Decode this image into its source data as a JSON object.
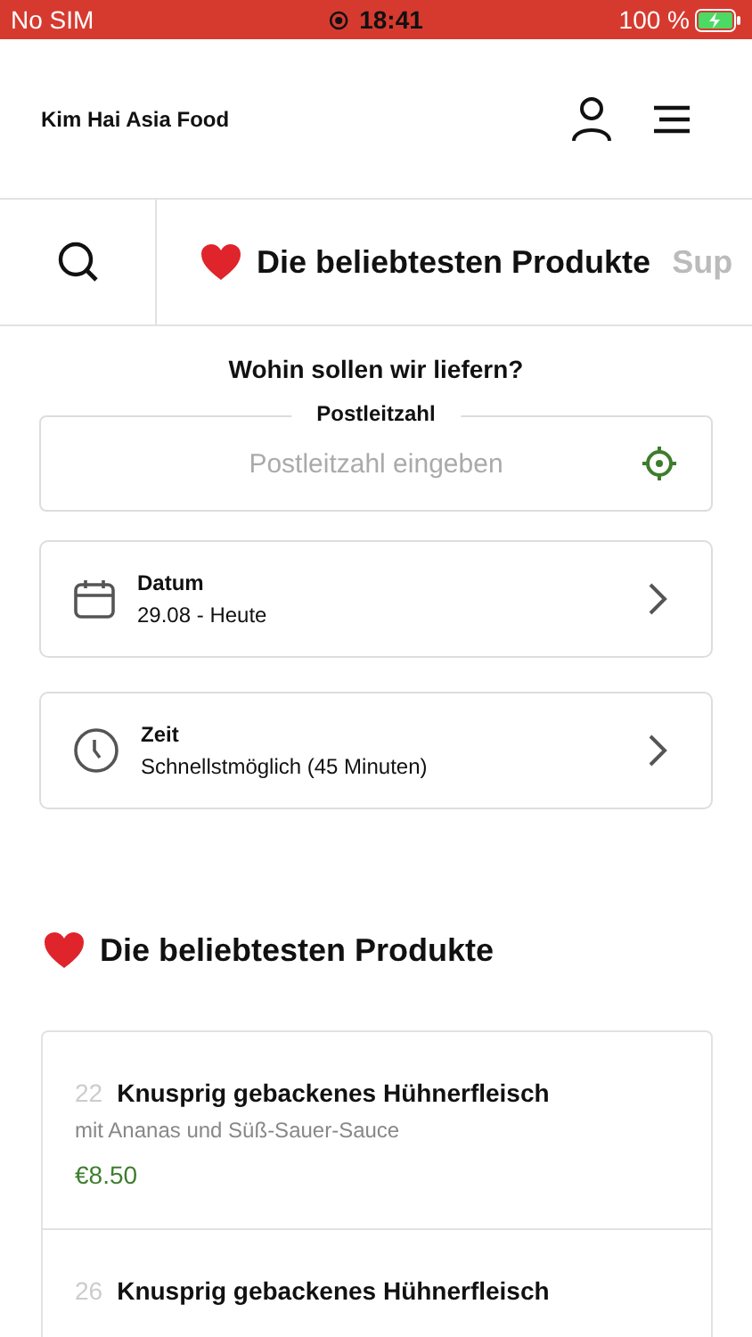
{
  "status_bar": {
    "carrier": "No SIM",
    "time": "18:41",
    "battery": "100 %"
  },
  "header": {
    "title": "Kim Hai Asia Food"
  },
  "tabs": [
    {
      "label": "Die beliebtesten Produkte",
      "selected": true,
      "heart": true
    },
    {
      "label": "Sup",
      "selected": false,
      "heart": false
    }
  ],
  "delivery": {
    "heading": "Wohin sollen wir liefern?",
    "postcode": {
      "label": "Postleitzahl",
      "placeholder": "Postleitzahl eingeben"
    },
    "options": [
      {
        "kind": "date",
        "title": "Datum",
        "value": "29.08 - Heute"
      },
      {
        "kind": "time",
        "title": "Zeit",
        "value": "Schnellstmöglich (45 Minuten)"
      }
    ]
  },
  "section": {
    "title": "Die beliebtesten Produkte"
  },
  "products": [
    {
      "number": "22",
      "name": "Knusprig gebackenes Hühnerfleisch",
      "description": "mit Ananas und Süß-Sauer-Sauce",
      "price": "€8.50"
    },
    {
      "number": "26",
      "name": "Knusprig gebackenes Hühnerfleisch"
    }
  ]
}
